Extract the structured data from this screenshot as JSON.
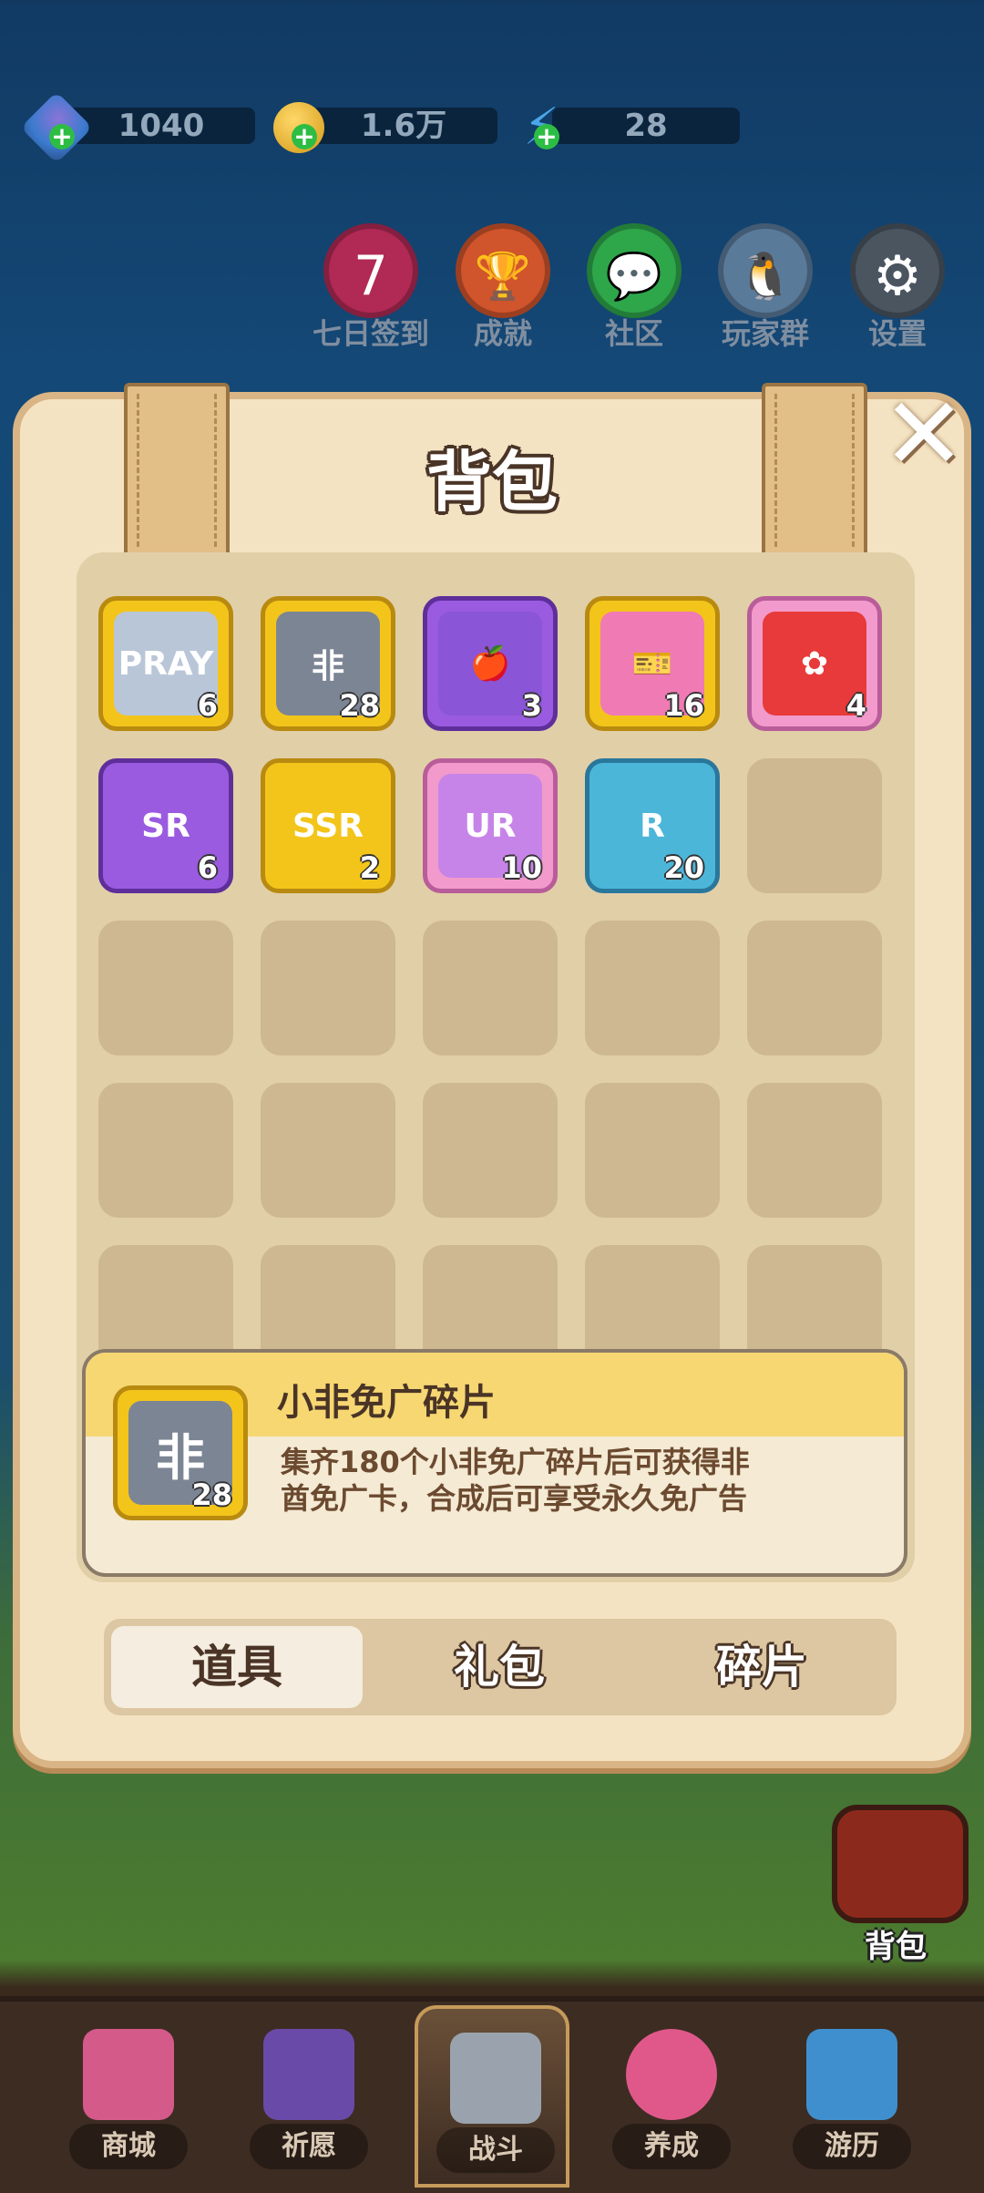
{
  "hud": {
    "gems": "1040",
    "coins": "1.6万",
    "energy": "28"
  },
  "top_buttons": [
    {
      "label": "七日签到",
      "icon": "seven-day-icon",
      "glyph": "7",
      "color": "#b02a55"
    },
    {
      "label": "成就",
      "icon": "trophy-icon",
      "glyph": "🏆",
      "color": "#d0542c"
    },
    {
      "label": "社区",
      "icon": "chat-icon",
      "glyph": "💬",
      "color": "#2ea64a"
    },
    {
      "label": "玩家群",
      "icon": "qq-penguin-icon",
      "glyph": "🐧",
      "color": "#5a7a9a"
    },
    {
      "label": "设置",
      "icon": "gear-icon",
      "glyph": "⚙",
      "color": "#4a5560"
    }
  ],
  "panel": {
    "title": "背包",
    "close_glyph": "✕"
  },
  "items": [
    {
      "name": "pray-ticket",
      "face": "PRAY",
      "count": "6",
      "frame": "gold",
      "color": "#b9c6d8"
    },
    {
      "name": "fei-shard",
      "face": "非",
      "count": "28",
      "frame": "gold",
      "color": "#7c8594"
    },
    {
      "name": "apple",
      "face": "🍎",
      "count": "3",
      "frame": "purple",
      "color": "#8a55d6"
    },
    {
      "name": "pink-ticket",
      "face": "🎫",
      "count": "16",
      "frame": "gold",
      "color": "#f07ab4"
    },
    {
      "name": "plum-blossom",
      "face": "✿",
      "count": "4",
      "frame": "pink",
      "color": "#e83a3a"
    },
    {
      "name": "sr-shard",
      "face": "SR",
      "count": "6",
      "frame": "purple",
      "color": "#9a5be0"
    },
    {
      "name": "ssr-shard",
      "face": "SSR",
      "count": "2",
      "frame": "gold",
      "color": "#f3c51b"
    },
    {
      "name": "ur-shard",
      "face": "UR",
      "count": "10",
      "frame": "pink",
      "color": "#c784e8"
    },
    {
      "name": "r-shard",
      "face": "R",
      "count": "20",
      "frame": "teal",
      "color": "#4cb6d9"
    }
  ],
  "detail": {
    "name": "小非免广碎片",
    "description": "集齐180个小非免广碎片后可获得非酋免广卡，合成后可享受永久免广告",
    "face": "非",
    "count": "28"
  },
  "tabs": [
    "道具",
    "礼包",
    "碎片"
  ],
  "bag_button": {
    "label": "背包"
  },
  "bottom_nav": [
    {
      "label": "商城",
      "icon": "shop-icon",
      "color": "#d45a8a"
    },
    {
      "label": "祈愿",
      "icon": "wish-card-icon",
      "color": "#6a4aa8"
    },
    {
      "label": "战斗",
      "icon": "crossed-swords-icon",
      "color": "#9aa3ad"
    },
    {
      "label": "养成",
      "icon": "paw-icon",
      "color": "#e0588a"
    },
    {
      "label": "游历",
      "icon": "map-icon",
      "color": "#3f8fcf"
    }
  ]
}
